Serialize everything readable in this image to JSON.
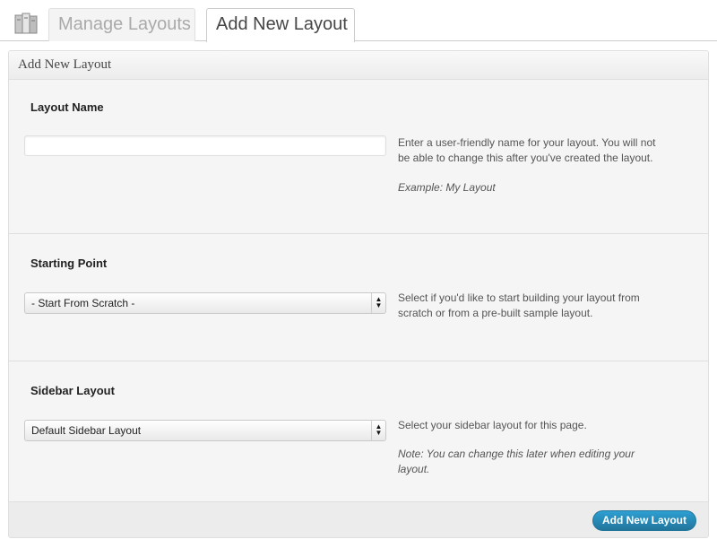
{
  "tabs": {
    "manage_label": "Manage Layouts",
    "add_label": "Add New Layout"
  },
  "box": {
    "title": "Add New Layout"
  },
  "layout_name": {
    "label": "Layout Name",
    "value": "",
    "description": "Enter a user-friendly name for your layout. You will not be able to change this after you've created the layout.",
    "example": "Example: My Layout"
  },
  "starting_point": {
    "label": "Starting Point",
    "selected": "- Start From Scratch -",
    "description": "Select if you'd like to start building your layout from scratch or from a pre-built sample layout."
  },
  "sidebar_layout": {
    "label": "Sidebar Layout",
    "selected": "Default Sidebar Layout",
    "description": "Select your sidebar layout for this page.",
    "note": "Note: You can change this later when editing your layout."
  },
  "footer": {
    "submit_label": "Add New Layout"
  },
  "colors": {
    "accent": "#21759b",
    "accent_light": "#2e9fd2"
  }
}
